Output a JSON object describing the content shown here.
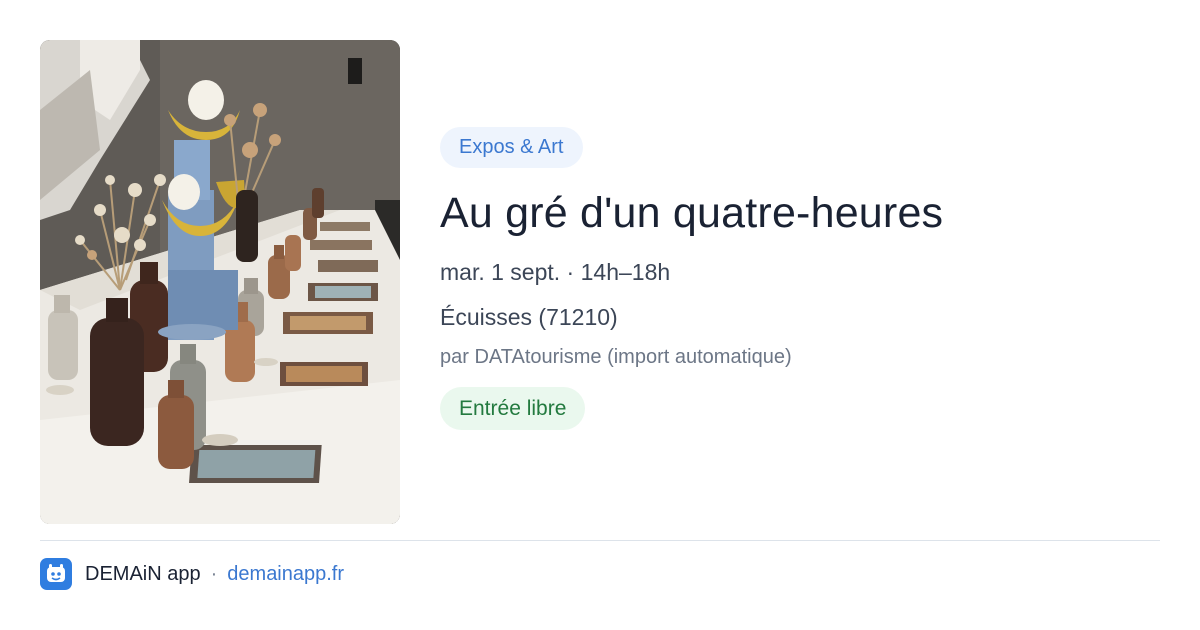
{
  "event": {
    "category": "Expos & Art",
    "title": "Au gré d'un quatre-heures",
    "datetime": "mar. 1 sept. · 14h–18h",
    "location": "Écuisses (71210)",
    "source": "par DATAtourisme (import automatique)",
    "price": "Entrée libre"
  },
  "footer": {
    "app_name": "DEMAiN app",
    "separator": "·",
    "site": "demainapp.fr"
  },
  "colors": {
    "category_badge_bg": "#eef4fd",
    "category_badge_text": "#3b78d0",
    "price_badge_bg": "#eaf8ee",
    "price_badge_text": "#237a3f",
    "link": "#3b78d0",
    "logo_bg": "#2f7de0"
  },
  "icons": {
    "app_logo": "demain-app-logo-icon"
  }
}
